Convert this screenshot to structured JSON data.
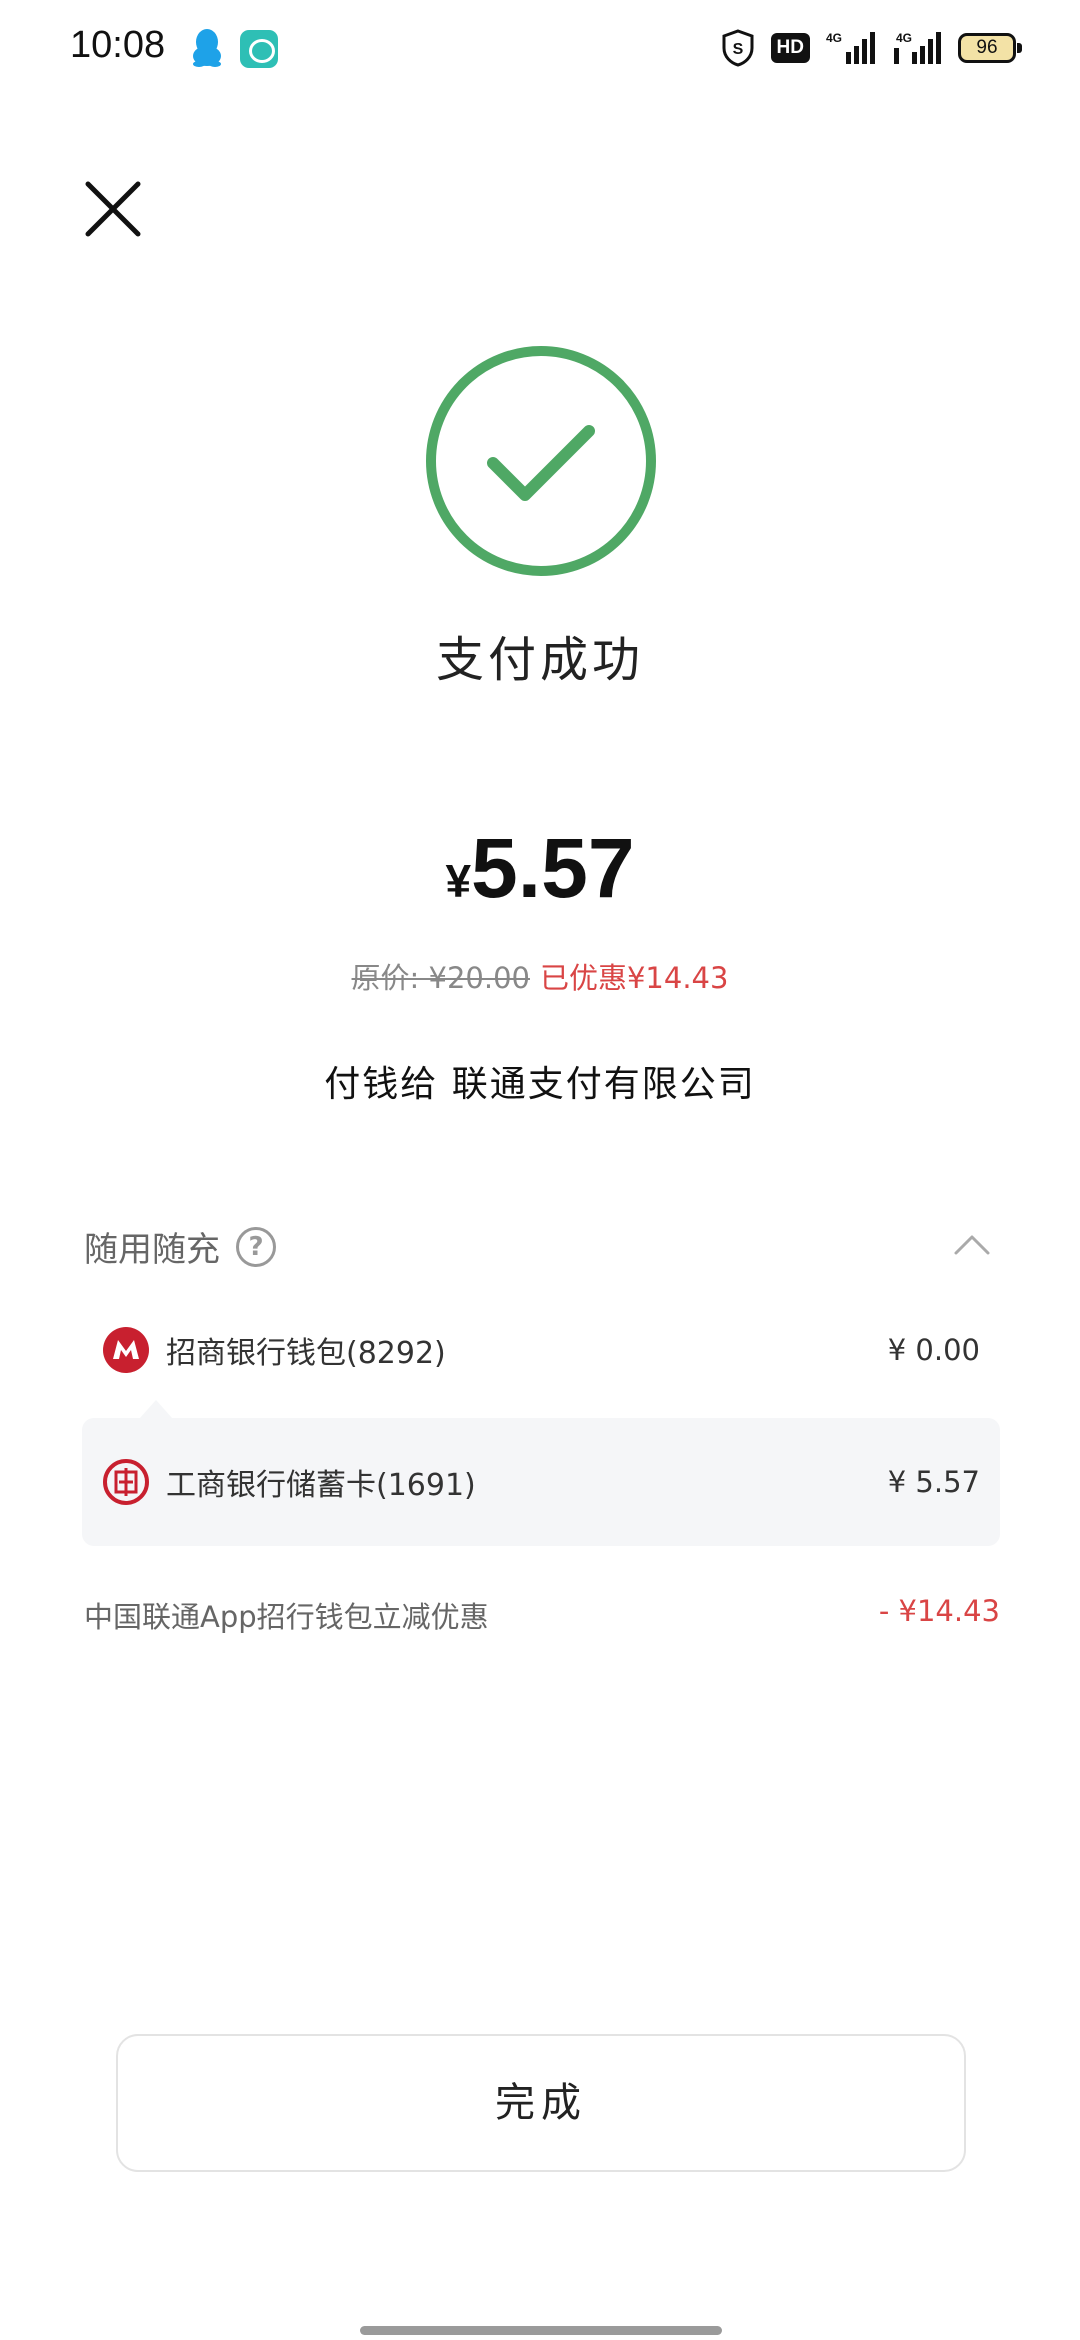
{
  "status_bar": {
    "time": "10:08",
    "hd_label": "HD",
    "battery": "96",
    "icons": [
      "qq-icon",
      "message-icon",
      "shield-icon",
      "signal-4g-icon",
      "signal-4g-icon"
    ]
  },
  "header": {
    "close_icon": "close-icon"
  },
  "result": {
    "status_icon": "check-circle-icon",
    "status_color": "#4fa865",
    "title": "支付成功",
    "currency": "¥",
    "amount": "5.57",
    "original_price": "原价: ¥20.00",
    "discount": "已优惠¥14.43",
    "payee": "付钱给 联通支付有限公司"
  },
  "payment_section": {
    "title": "随用随充",
    "help_icon": "help-icon",
    "collapse_icon": "chevron-up-icon",
    "methods": [
      {
        "name": "招商银行钱包(8292)",
        "amount": "¥ 0.00",
        "logo": "cmb-logo",
        "selected": false
      },
      {
        "name": "工商银行储蓄卡(1691)",
        "amount": "¥ 5.57",
        "logo": "icbc-logo",
        "selected": true
      }
    ]
  },
  "promo": {
    "label": "中国联通App招行钱包立减优惠",
    "value": "- ¥14.43",
    "value_color": "#d94545"
  },
  "done_button": {
    "label": "完成"
  }
}
